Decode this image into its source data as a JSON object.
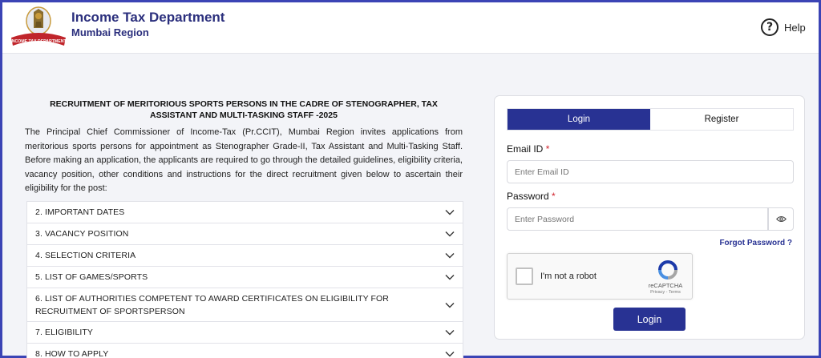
{
  "header": {
    "title": "Income Tax Department",
    "subtitle": "Mumbai Region",
    "logo_text": "INCOME TAX DEPARTMENT",
    "help_label": "Help"
  },
  "recruitment": {
    "title": "RECRUITMENT OF MERITORIOUS SPORTS PERSONS IN THE CADRE OF STENOGRAPHER, TAX ASSISTANT AND MULTI-TASKING STAFF -2025",
    "intro": "The Principal Chief Commissioner of Income-Tax (Pr.CCIT), Mumbai Region invites applications from meritorious sports persons for appointment as Stenographer Grade-II, Tax Assistant and Multi-Tasking Staff. Before making an application, the applicants are required to go through the detailed guidelines, eligibility criteria, vacancy position, other conditions and instructions for the direct recruitment given below to ascertain their eligibility for the post:"
  },
  "accordion": [
    {
      "label": "2. IMPORTANT DATES"
    },
    {
      "label": "3. VACANCY POSITION"
    },
    {
      "label": "4. SELECTION CRITERIA"
    },
    {
      "label": "5. LIST OF GAMES/SPORTS"
    },
    {
      "label": "6. LIST OF AUTHORITIES COMPETENT TO AWARD CERTIFICATES ON ELIGIBILITY FOR RECRUITMENT OF SPORTSPERSON"
    },
    {
      "label": "7. ELIGIBILITY"
    },
    {
      "label": "8. HOW TO APPLY"
    }
  ],
  "login": {
    "tab_login": "Login",
    "tab_register": "Register",
    "email_label": "Email ID",
    "email_placeholder": "Enter Email ID",
    "email_value": "",
    "password_label": "Password",
    "password_placeholder": "Enter Password",
    "password_value": "",
    "required_mark": "*",
    "forgot_label": "Forgot Password ?",
    "captcha_text": "I'm not a robot",
    "captcha_brand": "reCAPTCHA",
    "captcha_links": "Privacy - Terms",
    "submit_label": "Login"
  },
  "colors": {
    "primary": "#283293",
    "heading": "#2b2f7d",
    "required": "#d0222c",
    "frame": "#3b44b5"
  }
}
